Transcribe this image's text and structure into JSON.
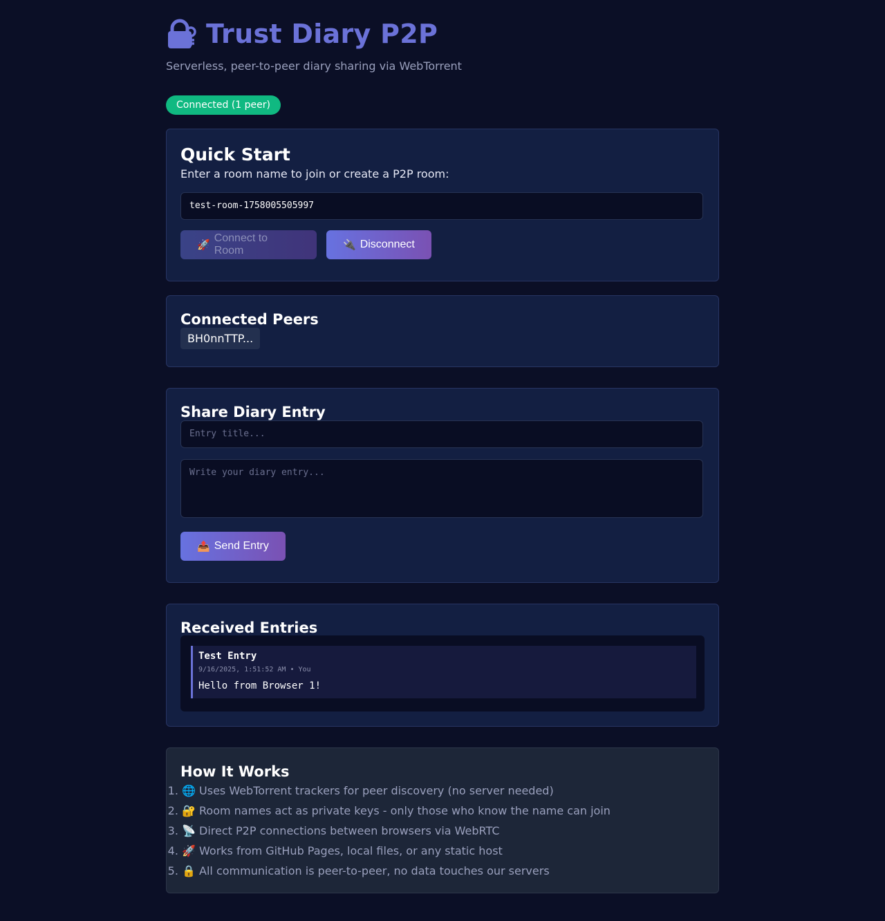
{
  "header": {
    "logo_icon": "lock-key-icon",
    "title": "Trust Diary P2P",
    "subtitle": "Serverless, peer-to-peer diary sharing via WebTorrent"
  },
  "status": {
    "text": "Connected (1 peer)",
    "color": "#10b981"
  },
  "quick_start": {
    "heading": "Quick Start",
    "prompt": "Enter a room name to join or create a P2P room:",
    "room_input_value": "test-room-1758005505997",
    "connect_icon": "🚀",
    "connect_label": "Connect to Room",
    "disconnect_icon": "🔌",
    "disconnect_label": "Disconnect"
  },
  "peers": {
    "heading": "Connected Peers",
    "items": [
      "BH0nnTTP..."
    ]
  },
  "share": {
    "heading": "Share Diary Entry",
    "title_placeholder": "Entry title...",
    "body_placeholder": "Write your diary entry...",
    "send_icon": "📤",
    "send_label": "Send Entry"
  },
  "received": {
    "heading": "Received Entries",
    "entries": [
      {
        "title": "Test Entry",
        "meta": "9/16/2025, 1:51:52 AM • You",
        "body": "Hello from Browser 1!"
      }
    ]
  },
  "how": {
    "heading": "How It Works",
    "steps": [
      {
        "icon": "🌐",
        "text": "Uses WebTorrent trackers for peer discovery (no server needed)"
      },
      {
        "icon": "🔐",
        "text": "Room names act as private keys - only those who know the name can join"
      },
      {
        "icon": "📡",
        "text": "Direct P2P connections between browsers via WebRTC"
      },
      {
        "icon": "🚀",
        "text": "Works from GitHub Pages, local files, or any static host"
      },
      {
        "icon": "🔒",
        "text": "All communication is peer-to-peer, no data touches our servers"
      }
    ]
  },
  "colors": {
    "accent": "#6b72d8",
    "background": "#0b0f26",
    "card": "#131f42"
  }
}
